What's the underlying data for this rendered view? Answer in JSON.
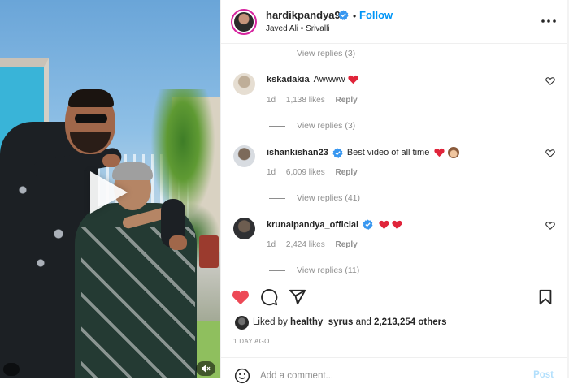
{
  "colors": {
    "accent_blue": "#0095f6",
    "verified_blue": "#3897f0",
    "heart_red": "#ed4956",
    "secondary_text": "#8e8e8e",
    "primary_text": "#262626"
  },
  "media": {
    "play_icon": "play-icon",
    "mute_icon": "speaker-muted-icon"
  },
  "header": {
    "username": "hardikpandya93",
    "dot": "•",
    "follow_label": "Follow",
    "audio": "Javed Ali • Srivalli",
    "more_icon": "more-horizontal-icon"
  },
  "comments": [
    {
      "type": "replies",
      "view_replies": "View replies (3)"
    },
    {
      "type": "comment",
      "username": "kskadakia",
      "text": "Awwww",
      "emojis": [
        "red-heart"
      ],
      "age": "1d",
      "likes": "1,138 likes",
      "reply": "Reply",
      "view_replies": "View replies (3)"
    },
    {
      "type": "comment",
      "username": "ishankishan23",
      "verified": true,
      "text": "Best video of all time",
      "emojis": [
        "red-heart",
        "see-no-evil-monkey"
      ],
      "age": "1d",
      "likes": "6,009 likes",
      "reply": "Reply",
      "view_replies": "View replies (41)"
    },
    {
      "type": "comment",
      "username": "krunalpandya_official",
      "verified": true,
      "text": "",
      "emojis": [
        "red-heart",
        "red-heart"
      ],
      "age": "1d",
      "likes": "2,424 likes",
      "reply": "Reply",
      "view_replies": "View replies (11)"
    }
  ],
  "actions": {
    "like_icon": "heart-filled-icon",
    "comment_icon": "comment-icon",
    "share_icon": "share-icon",
    "save_icon": "bookmark-icon"
  },
  "likes": {
    "prefix": "Liked by",
    "user": "healthy_syrus",
    "joiner": "and",
    "others": "2,213,254 others"
  },
  "timestamp": "1 DAY AGO",
  "add_comment": {
    "placeholder": "Add a comment...",
    "post_label": "Post",
    "emoji_icon": "smiley-icon"
  }
}
